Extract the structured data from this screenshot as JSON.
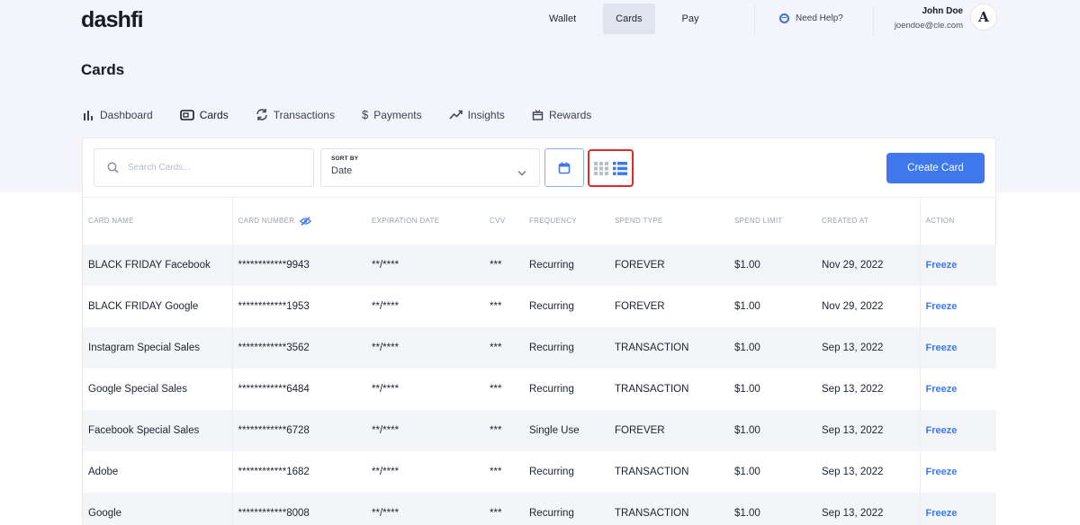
{
  "header": {
    "logo": "dashfi",
    "nav": [
      "Wallet",
      "Cards",
      "Pay"
    ],
    "active_nav": "Cards",
    "help": "Need Help?",
    "user_name": "John Doe",
    "user_email": "joendoe@cle.com",
    "avatar_initial": "A"
  },
  "page": {
    "title": "Cards",
    "tabs": [
      "Dashboard",
      "Cards",
      "Transactions",
      "Payments",
      "Insights",
      "Rewards"
    ]
  },
  "toolbar": {
    "search_placeholder": "Search Cards...",
    "sort_label": "SORT BY",
    "sort_value": "Date",
    "create_label": "Create Card"
  },
  "table": {
    "columns": [
      "CARD NAME",
      "CARD NUMBER",
      "EXPIRATION DATE",
      "CVV",
      "FREQUENCY",
      "SPEND TYPE",
      "SPEND LIMIT",
      "CREATED AT",
      "ACTION"
    ],
    "rows": [
      {
        "name": "BLACK FRIDAY Facebook",
        "number": "************9943",
        "exp": "**/****",
        "cvv": "***",
        "frequency": "Recurring",
        "spend_type": "FOREVER",
        "limit": "$1.00",
        "created": "Nov 29, 2022",
        "action": "Freeze"
      },
      {
        "name": "BLACK FRIDAY Google",
        "number": "************1953",
        "exp": "**/****",
        "cvv": "***",
        "frequency": "Recurring",
        "spend_type": "FOREVER",
        "limit": "$1.00",
        "created": "Nov 29, 2022",
        "action": "Freeze"
      },
      {
        "name": "Instagram Special Sales",
        "number": "************3562",
        "exp": "**/****",
        "cvv": "***",
        "frequency": "Recurring",
        "spend_type": "TRANSACTION",
        "limit": "$1.00",
        "created": "Sep 13, 2022",
        "action": "Freeze"
      },
      {
        "name": "Google Special Sales",
        "number": "************6484",
        "exp": "**/****",
        "cvv": "***",
        "frequency": "Recurring",
        "spend_type": "TRANSACTION",
        "limit": "$1.00",
        "created": "Sep 13, 2022",
        "action": "Freeze"
      },
      {
        "name": "Facebook Special Sales",
        "number": "************6728",
        "exp": "**/****",
        "cvv": "***",
        "frequency": "Single Use",
        "spend_type": "FOREVER",
        "limit": "$1.00",
        "created": "Sep 13, 2022",
        "action": "Freeze"
      },
      {
        "name": "Adobe",
        "number": "************1682",
        "exp": "**/****",
        "cvv": "***",
        "frequency": "Recurring",
        "spend_type": "TRANSACTION",
        "limit": "$1.00",
        "created": "Sep 13, 2022",
        "action": "Freeze"
      },
      {
        "name": "Google",
        "number": "************8008",
        "exp": "**/****",
        "cvv": "***",
        "frequency": "Recurring",
        "spend_type": "TRANSACTION",
        "limit": "$1.00",
        "created": "Sep 13, 2022",
        "action": "Freeze"
      }
    ]
  },
  "icons": {
    "search": "search-icon",
    "chevron": "chevron-down-icon",
    "calendar": "calendar-icon",
    "grid_view": "grid-view-icon",
    "list_view": "list-view-icon",
    "eye_off": "eye-off-icon",
    "help": "globe-icon"
  },
  "colors": {
    "accent": "#3f78ec",
    "highlight_border": "#e02828",
    "top_band": "#f3f5fa"
  }
}
